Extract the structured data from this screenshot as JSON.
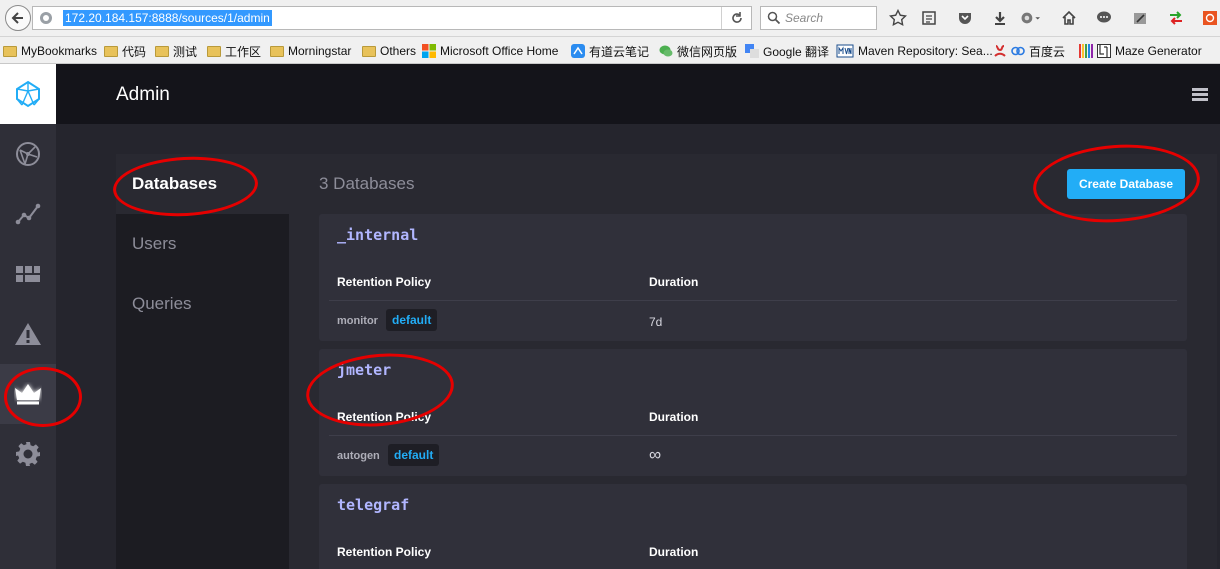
{
  "browser": {
    "url": "172.20.184.157:8888/sources/1/admin",
    "search_placeholder": "Search",
    "bookmarks": [
      {
        "label": "MyBookmarks",
        "kind": "folder"
      },
      {
        "label": "代码",
        "kind": "folder"
      },
      {
        "label": "测试",
        "kind": "folder"
      },
      {
        "label": "工作区",
        "kind": "folder"
      },
      {
        "label": "Morningstar",
        "kind": "folder"
      },
      {
        "label": "Others",
        "kind": "folder"
      },
      {
        "label": "Microsoft Office Home",
        "kind": "ms-office-icon"
      },
      {
        "label": "有道云笔记",
        "kind": "note-icon"
      },
      {
        "label": "微信网页版",
        "kind": "wechat-icon"
      },
      {
        "label": "Google 翻译",
        "kind": "translate-icon"
      },
      {
        "label": "Maven Repository: Sea...",
        "kind": "mvn-icon"
      },
      {
        "label": "百度云",
        "kind": "cloud-icon"
      },
      {
        "label": "Maze Generator",
        "kind": "maze-icon"
      }
    ]
  },
  "header": {
    "title": "Admin"
  },
  "subnav": {
    "items": [
      {
        "label": "Databases",
        "active": true
      },
      {
        "label": "Users",
        "active": false
      },
      {
        "label": "Queries",
        "active": false
      }
    ]
  },
  "panel": {
    "title": "3 Databases",
    "create_label": "Create Database",
    "columns": {
      "policy": "Retention Policy",
      "duration": "Duration"
    },
    "databases": [
      {
        "name": "_internal",
        "policy": "monitor",
        "badge": "default",
        "duration": "7d"
      },
      {
        "name": "jmeter",
        "policy": "autogen",
        "badge": "default",
        "duration": "∞"
      },
      {
        "name": "telegraf"
      }
    ]
  },
  "colors": {
    "accent": "#22adf6",
    "db_name": "#b1b6ff",
    "annotation": "#e60000"
  }
}
